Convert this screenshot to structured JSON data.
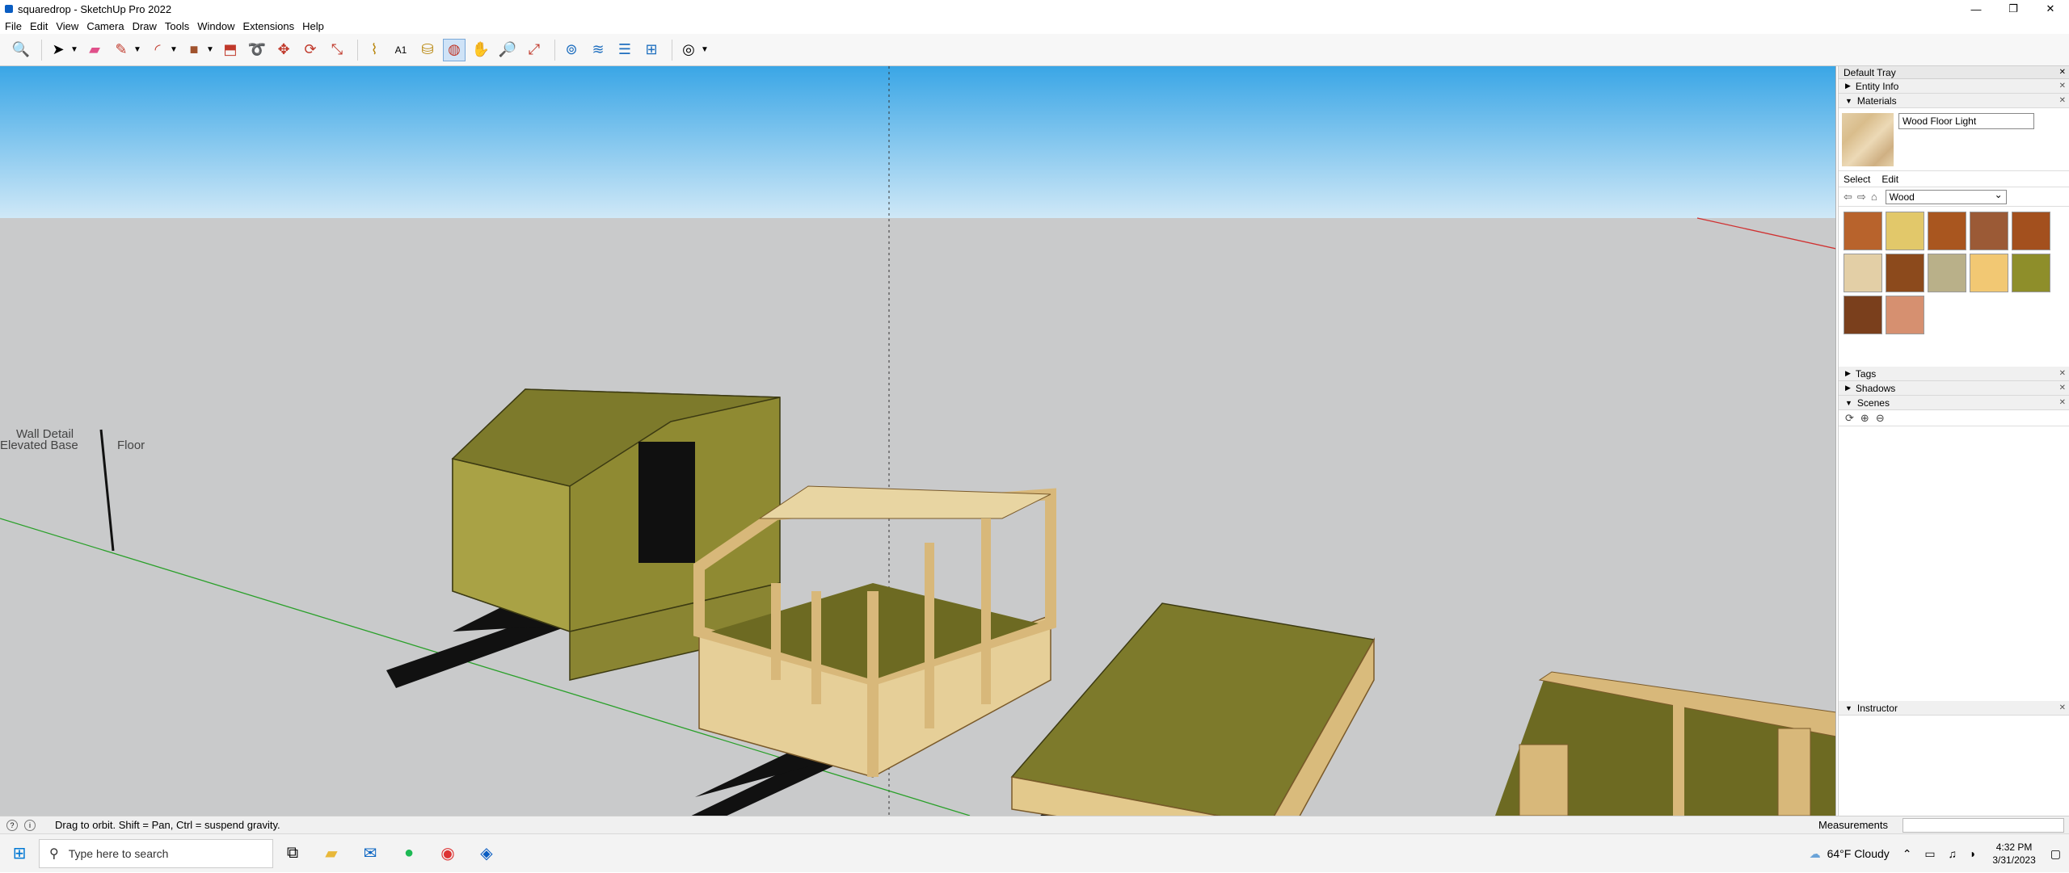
{
  "window": {
    "title": "squaredrop - SketchUp Pro 2022",
    "controls": {
      "minimize": "—",
      "restore": "❐",
      "close": "✕"
    }
  },
  "menu": [
    "File",
    "Edit",
    "View",
    "Camera",
    "Draw",
    "Tools",
    "Window",
    "Extensions",
    "Help"
  ],
  "toolbar": {
    "icons": [
      "search-icon",
      "select-icon",
      "eraser-icon",
      "pencil-icon",
      "arc-icon",
      "shape-icon",
      "push-pull-icon",
      "follow-me-icon",
      "move-icon",
      "rotate-icon",
      "scale-icon",
      "tape-icon",
      "text-icon",
      "paint-icon",
      "orbit-icon",
      "pan-icon",
      "zoom-icon",
      "zoom-extents-icon",
      "warehouse-icon",
      "extension-icon",
      "layers-icon",
      "section-icon",
      "user-icon"
    ],
    "active": "orbit-icon"
  },
  "viewport": {
    "labels": {
      "wall_detail": "Wall Detail",
      "elevated_base": "Elevated Base",
      "floor": "Floor"
    }
  },
  "tray": {
    "title": "Default Tray",
    "panels": {
      "entity_info": "Entity Info",
      "materials": "Materials",
      "tags": "Tags",
      "shadows": "Shadows",
      "scenes": "Scenes",
      "instructor": "Instructor"
    },
    "material_name": "Wood Floor Light",
    "tabs": {
      "select": "Select",
      "edit": "Edit"
    },
    "collection": "Wood",
    "swatches": [
      "#b8632c",
      "#e2c86a",
      "#a9561f",
      "#9b5a36",
      "#a3501e",
      "#e3cfa6",
      "#8c4a1c",
      "#b9b089",
      "#f2c873",
      "#8e8e2a",
      "#7a3f1c",
      "#d69070"
    ]
  },
  "status": {
    "hint": "Drag to orbit. Shift = Pan, Ctrl = suspend gravity.",
    "measurements": "Measurements"
  },
  "taskbar": {
    "search_placeholder": "Type here to search",
    "weather": "64°F  Cloudy",
    "time": "4:32 PM",
    "date": "3/31/2023"
  }
}
